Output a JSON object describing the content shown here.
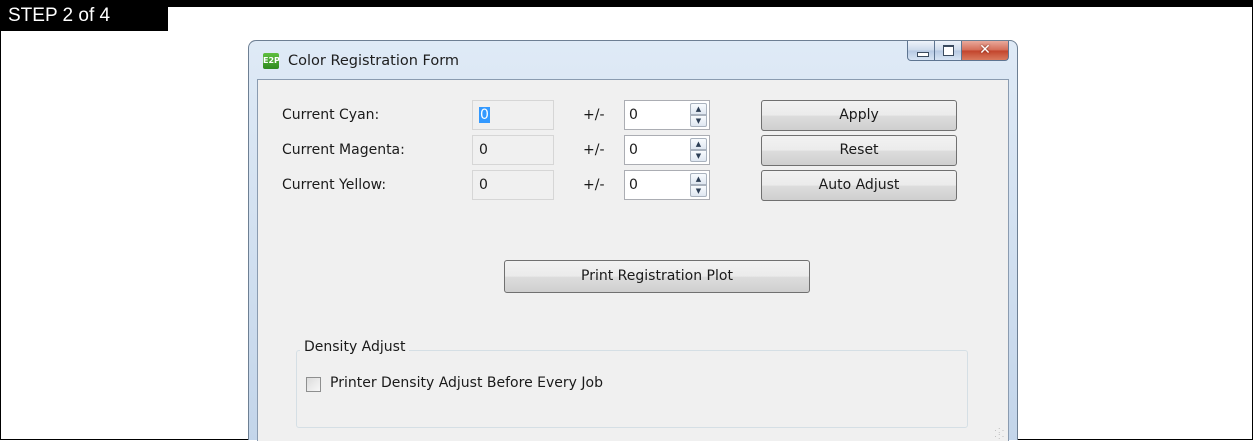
{
  "step_label": "STEP 2 of 4",
  "window": {
    "title": "Color Registration Form",
    "icon_label": "E2P",
    "caption_buttons": {
      "minimize": "minimize-icon",
      "maximize": "maximize-icon",
      "close": "✕"
    }
  },
  "rows": [
    {
      "label": "Current Cyan:",
      "current": "0",
      "pm": "+/-",
      "adjust": "0",
      "button": "Apply"
    },
    {
      "label": "Current Magenta:",
      "current": "0",
      "pm": "+/-",
      "adjust": "0",
      "button": "Reset"
    },
    {
      "label": "Current Yellow:",
      "current": "0",
      "pm": "+/-",
      "adjust": "0",
      "button": "Auto Adjust"
    }
  ],
  "print_button": "Print Registration Plot",
  "density": {
    "group_title": "Density Adjust",
    "checkbox_label": "Printer Density Adjust Before Every Job",
    "checked": false
  },
  "spin_arrows": {
    "up": "▲",
    "down": "▼"
  },
  "colors": {
    "selection": "#3399ff",
    "close_button": "#c2432b",
    "client_bg": "#f0f0f0"
  }
}
